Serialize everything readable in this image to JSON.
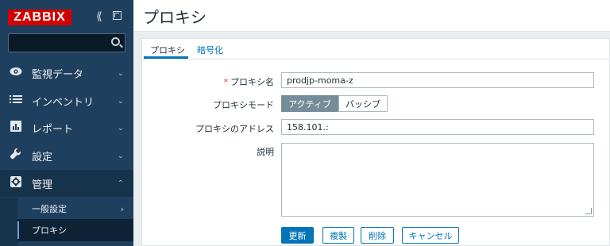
{
  "app": {
    "logo": "ZABBIX"
  },
  "sidebar": {
    "items": [
      {
        "label": "監視データ",
        "icon": "eye-icon"
      },
      {
        "label": "インベントリ",
        "icon": "list-icon"
      },
      {
        "label": "レポート",
        "icon": "bar-chart-icon"
      },
      {
        "label": "設定",
        "icon": "wrench-icon"
      },
      {
        "label": "管理",
        "icon": "gear-icon"
      }
    ],
    "submenu": [
      {
        "label": "一般設定"
      },
      {
        "label": "プロキシ"
      }
    ]
  },
  "page": {
    "title": "プロキシ"
  },
  "tabs": [
    {
      "label": "プロキシ"
    },
    {
      "label": "暗号化"
    }
  ],
  "form": {
    "name_label": "プロキシ名",
    "name_required": "*",
    "name_value": "prodjp-moma-z",
    "mode_label": "プロキシモード",
    "mode_options": [
      "アクティブ",
      "パッシブ"
    ],
    "address_label": "プロキシのアドレス",
    "address_value": "158.101.:",
    "desc_label": "説明"
  },
  "buttons": {
    "update": "更新",
    "clone": "複製",
    "delete": "削除",
    "cancel": "キャンセル"
  },
  "colors": {
    "sidebar": "#1f3f5e",
    "accent": "#0275b8",
    "logo": "#d40000"
  }
}
